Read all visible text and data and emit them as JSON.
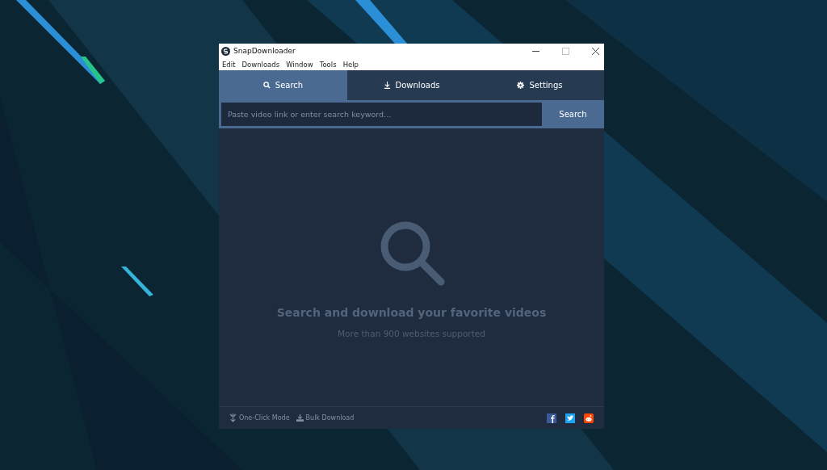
{
  "window": {
    "title": "SnapDownloader"
  },
  "menu": [
    "Edit",
    "Downloads",
    "Window",
    "Tools",
    "Help"
  ],
  "tabs": [
    {
      "label": "Search",
      "kind": "search",
      "selected": true
    },
    {
      "label": "Downloads",
      "kind": "download",
      "selected": false
    },
    {
      "label": "Settings",
      "kind": "settings",
      "selected": false
    }
  ],
  "search": {
    "placeholder": "Paste video link or enter search keyword...",
    "button": "Search"
  },
  "empty_state": {
    "heading": "Search and download your favorite videos",
    "subtext": "More than 900 websites supported"
  },
  "footer": {
    "actions": [
      {
        "label": "One-Click Mode",
        "kind": "one-click"
      },
      {
        "label": "Bulk Download",
        "kind": "bulk"
      }
    ],
    "social": [
      {
        "kind": "facebook",
        "color": "#3b5998"
      },
      {
        "kind": "twitter",
        "color": "#1da1f2"
      },
      {
        "kind": "reddit",
        "color": "#ff4500"
      }
    ]
  }
}
